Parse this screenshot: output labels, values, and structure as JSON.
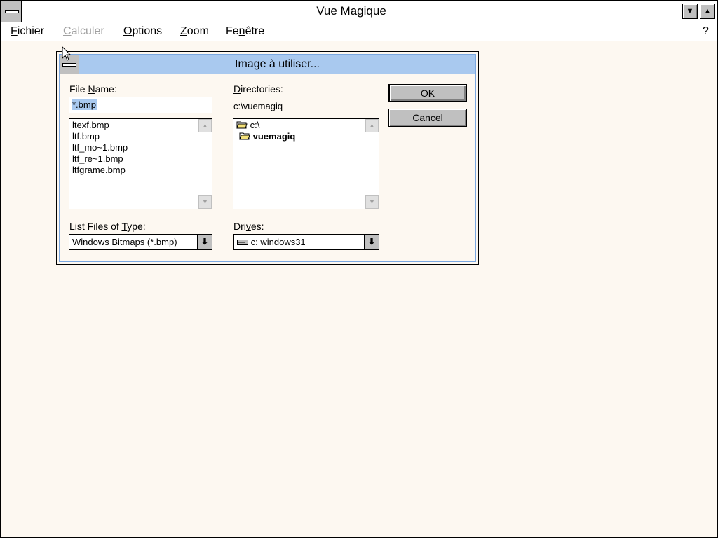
{
  "window": {
    "title": "Vue Magique",
    "help": "?"
  },
  "menu": {
    "items": [
      {
        "label": "Fichier",
        "accel": "F",
        "rest": "ichier",
        "disabled": false
      },
      {
        "label": "Calculer",
        "accel": "C",
        "rest": "alculer",
        "disabled": true
      },
      {
        "label": "Options",
        "accel": "O",
        "rest": "ptions",
        "disabled": false
      },
      {
        "label": "Zoom",
        "accel": "Z",
        "rest": "oom",
        "disabled": false
      },
      {
        "label": "Fenêtre",
        "pre": "Fe",
        "accel": "n",
        "rest": "être",
        "disabled": false
      }
    ]
  },
  "dialog": {
    "title": "Image à utiliser...",
    "file_name_label_pre": "File ",
    "file_name_label_accel": "N",
    "file_name_label_rest": "ame:",
    "file_name_value": "*.bmp",
    "files": [
      "ltexf.bmp",
      "ltf.bmp",
      "ltf_mo~1.bmp",
      "ltf_re~1.bmp",
      "ltfgrame.bmp"
    ],
    "directories_label_accel": "D",
    "directories_label_rest": "irectories:",
    "current_dir": "c:\\vuemagiq",
    "dirs": [
      "c:\\",
      "vuemagiq"
    ],
    "type_label_pre": "List Files of ",
    "type_label_accel": "T",
    "type_label_rest": "ype:",
    "type_value": "Windows Bitmaps  (*.bmp)",
    "drives_label_pre": "Dri",
    "drives_label_accel": "v",
    "drives_label_rest": "es:",
    "drive_value": "c: windows31",
    "ok_label": "OK",
    "cancel_label": "Cancel"
  },
  "colors": {
    "desktop": "#fdf8f1",
    "dialog_title": "#a9c9ef",
    "selection": "#a9c9ef"
  }
}
